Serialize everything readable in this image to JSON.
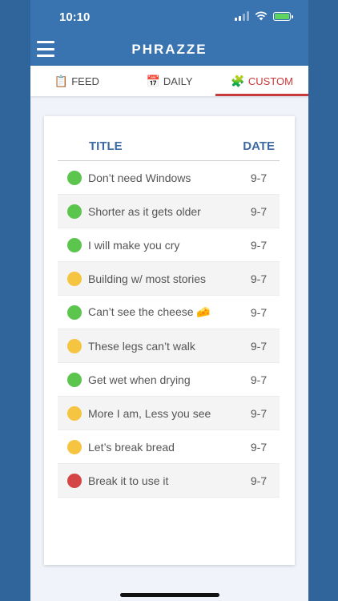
{
  "status": {
    "time": "10:10"
  },
  "app": {
    "title": "PHRAZZE"
  },
  "tabs": [
    {
      "icon": "📋",
      "label": "FEED",
      "active": false
    },
    {
      "icon": "📅",
      "label": "DAILY",
      "active": false
    },
    {
      "icon": "🧩",
      "label": "CUSTOM",
      "active": true
    }
  ],
  "table": {
    "columns": {
      "title": "TITLE",
      "date": "DATE"
    },
    "rows": [
      {
        "status": "green",
        "title": "Don’t need Windows",
        "date": "9-7"
      },
      {
        "status": "green",
        "title": "Shorter as it gets older",
        "date": "9-7"
      },
      {
        "status": "green",
        "title": "I will make you cry",
        "date": "9-7"
      },
      {
        "status": "yellow",
        "title": "Building w/ most stories",
        "date": "9-7"
      },
      {
        "status": "green",
        "title": "Can’t see the cheese 🧀",
        "date": "9-7"
      },
      {
        "status": "yellow",
        "title": "These legs can’t walk",
        "date": "9-7"
      },
      {
        "status": "green",
        "title": "Get wet when drying",
        "date": "9-7"
      },
      {
        "status": "yellow",
        "title": "More I am, Less you see",
        "date": "9-7"
      },
      {
        "status": "yellow",
        "title": "Let’s break bread",
        "date": "9-7"
      },
      {
        "status": "red",
        "title": "Break it to use it",
        "date": "9-7"
      }
    ]
  },
  "colors": {
    "green": "#5cc54e",
    "yellow": "#f5c542",
    "red": "#d64545",
    "header": "#3a74b0",
    "accent": "#c93b3b"
  }
}
